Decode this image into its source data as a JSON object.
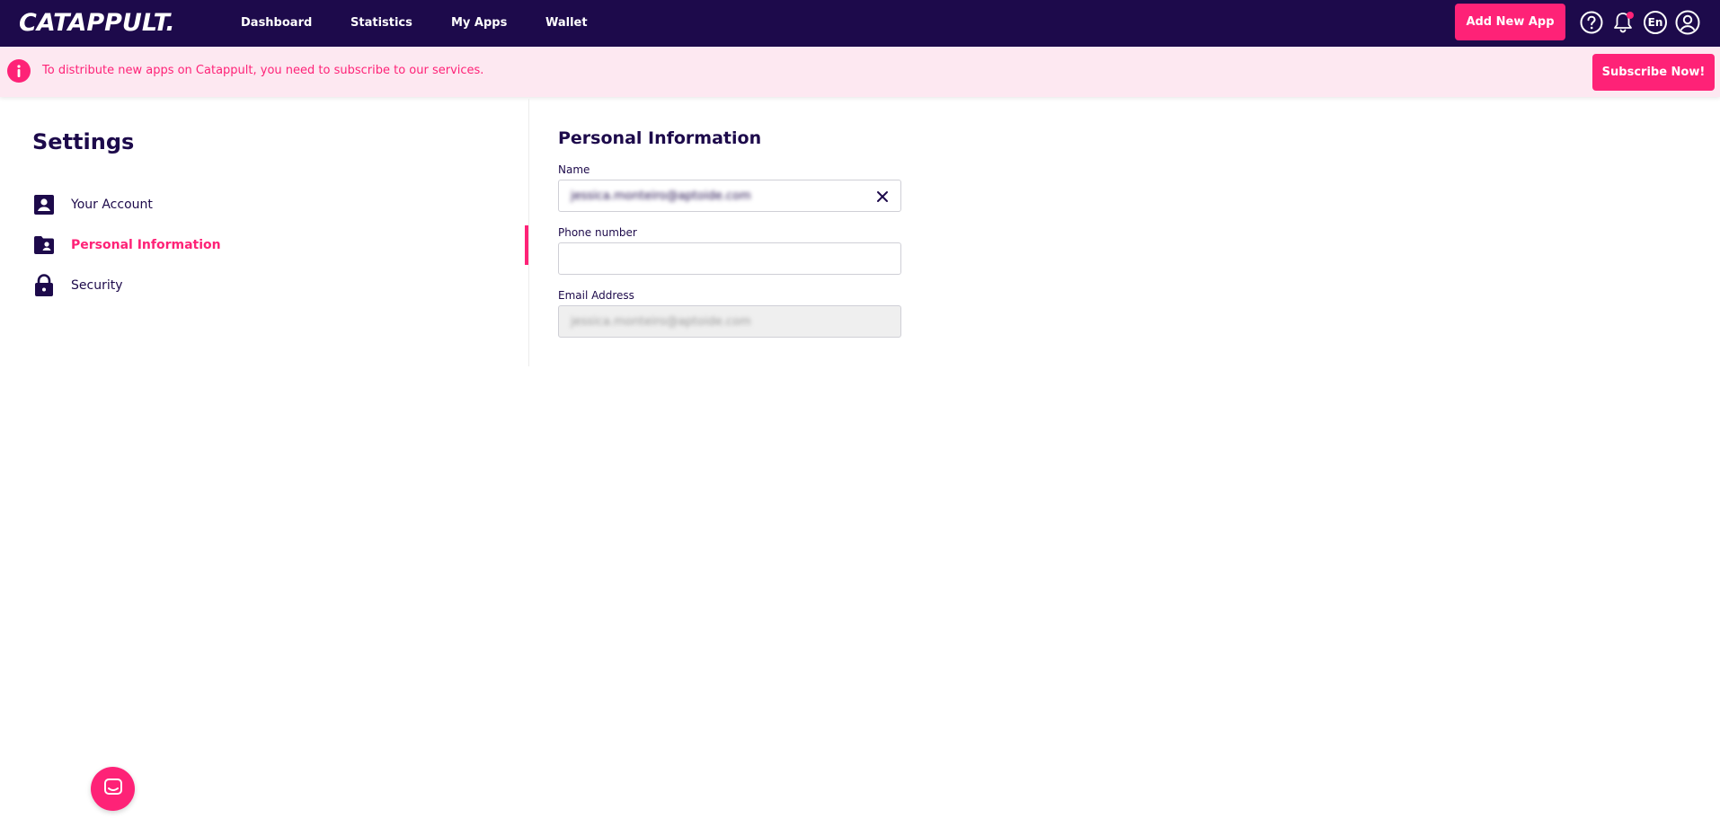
{
  "topbar": {
    "logo": "CATAPPULT.",
    "nav": [
      {
        "label": "Dashboard"
      },
      {
        "label": "Statistics"
      },
      {
        "label": "My Apps"
      },
      {
        "label": "Wallet"
      }
    ],
    "add_app_label": "Add New App",
    "language": "En",
    "icons": [
      "help-icon",
      "bell-icon",
      "language-icon",
      "user-profile-icon"
    ],
    "has_notification": true
  },
  "banner": {
    "text": "To distribute new apps on Catappult, you need to subscribe to our services.",
    "button_label": "Subscribe Now!",
    "icon": "info-icon"
  },
  "sidebar": {
    "title": "Settings",
    "items": [
      {
        "label": "Your Account",
        "icon": "account-box-icon",
        "active": false
      },
      {
        "label": "Personal Information",
        "icon": "contact-folder-icon",
        "active": true
      },
      {
        "label": "Security",
        "icon": "lock-icon",
        "active": false
      }
    ]
  },
  "form": {
    "title": "Personal Information",
    "name": {
      "label": "Name",
      "value": "jessica.monteiro@aptoide.com"
    },
    "phone": {
      "label": "Phone number",
      "value": "",
      "placeholder": ""
    },
    "email": {
      "label": "Email Address",
      "value": "jessica.monteiro@aptoide.com"
    }
  },
  "colors": {
    "nav_bg": "#1d0a4b",
    "accent": "#fe2277",
    "banner_bg": "#fde8f1",
    "text_primary": "#1d0a4b"
  }
}
